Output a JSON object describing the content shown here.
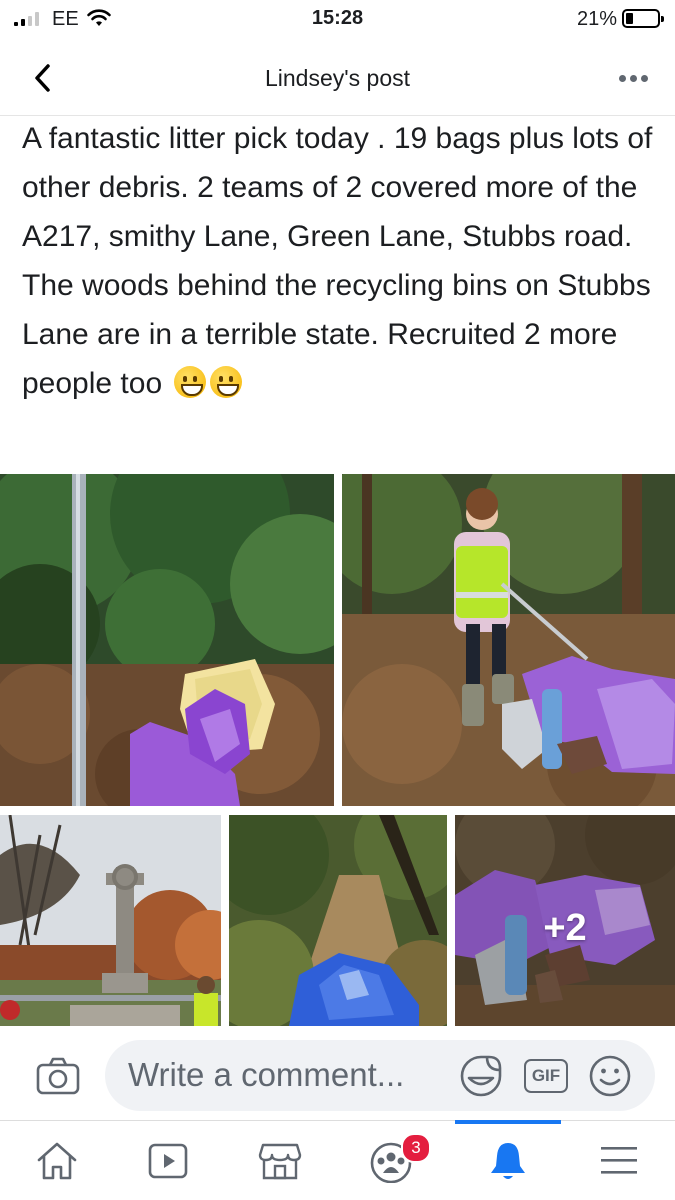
{
  "status_bar": {
    "carrier": "EE",
    "time": "15:28",
    "battery_percent": "21%",
    "battery_level": 0.21
  },
  "header": {
    "title": "Lindsey's post"
  },
  "post": {
    "text": "A fantastic litter pick today . 19 bags plus lots of other debris. 2 teams of 2 covered more of the A217, smithy Lane, Green Lane, Stubbs road. The woods behind the recycling bins on Stubbs Lane are in a terrible state. Recruited 2 more people too",
    "emojis": [
      "grinning-face",
      "grinning-face"
    ],
    "more_photos_label": "+2"
  },
  "comment_bar": {
    "placeholder": "Write a comment...",
    "gif_label": "GIF"
  },
  "tab_bar": {
    "notification_badge": "3",
    "active_tab": "notifications"
  },
  "colors": {
    "accent": "#1877f2",
    "badge": "#e41e3f",
    "input_bg": "#f0f2f5"
  }
}
